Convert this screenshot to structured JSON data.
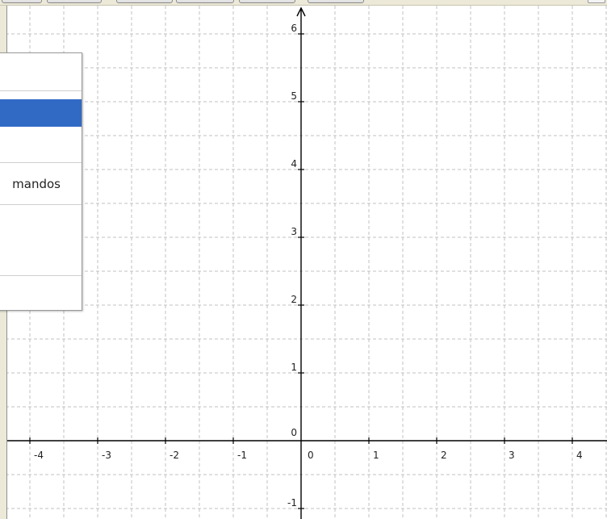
{
  "window": {
    "top_toolbar": {
      "buttons": [
        "",
        "",
        "",
        "",
        "",
        ""
      ]
    }
  },
  "context_menu": {
    "items": [
      {
        "label": "",
        "selected": false
      },
      {
        "label": "",
        "selected": true
      },
      {
        "label": "",
        "selected": false
      },
      {
        "label": "mandos",
        "selected": false
      },
      {
        "label": "",
        "selected": false
      },
      {
        "label": "",
        "selected": false
      }
    ]
  },
  "graphics_view": {
    "x_tick_labels": [
      "-4",
      "-3",
      "-2",
      "-1",
      "0",
      "1",
      "2",
      "3",
      "4"
    ],
    "y_tick_labels": [
      "-1",
      "0",
      "1",
      "2",
      "3",
      "4",
      "5",
      "6"
    ],
    "grid": true,
    "x_range": [
      -4.3,
      4.5
    ],
    "y_range": [
      -1.2,
      6.4
    ],
    "colors": {
      "axis": "#000000",
      "grid": "#c0c0c0",
      "selection": "#316ac5"
    }
  }
}
